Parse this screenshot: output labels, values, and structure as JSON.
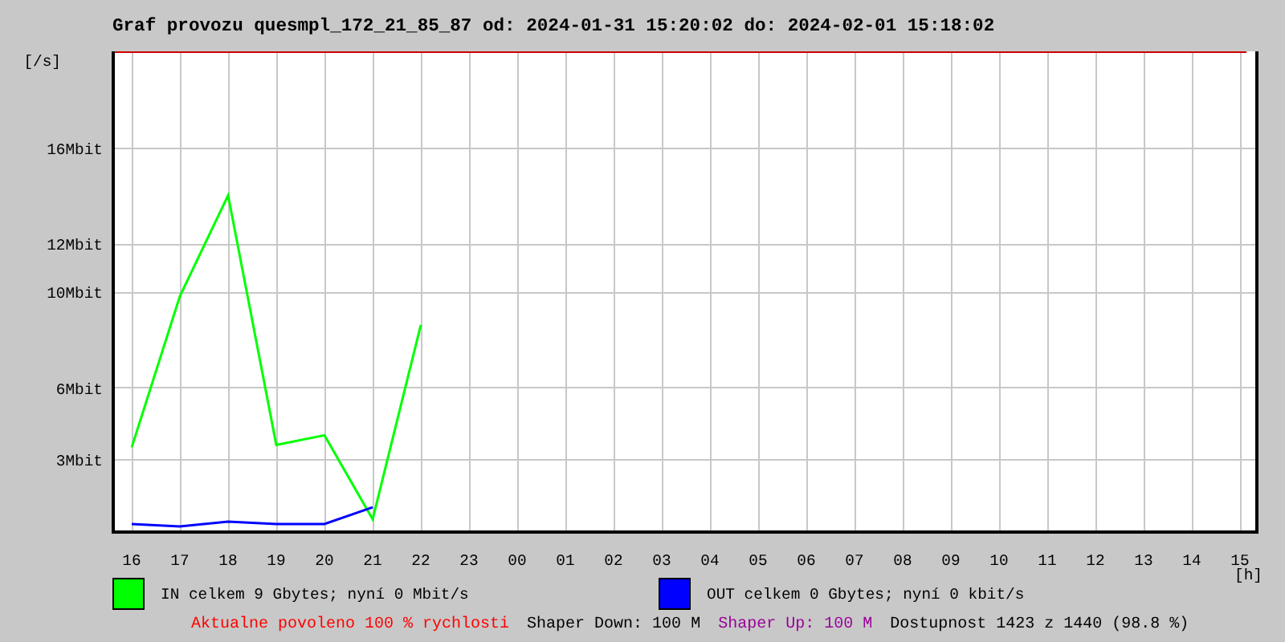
{
  "title": "Graf provozu quesmpl_172_21_85_87 od: 2024-01-31 15:20:02 do: 2024-02-01 15:18:02",
  "chart_data": {
    "type": "line",
    "ylabel": "[/s]",
    "xlabel": "[h]",
    "grid": true,
    "ylim": [
      0,
      20
    ],
    "yticks": [
      {
        "value": 3,
        "label": "3Mbit"
      },
      {
        "value": 6,
        "label": "6Mbit"
      },
      {
        "value": 10,
        "label": "10Mbit"
      },
      {
        "value": 12,
        "label": "12Mbit"
      },
      {
        "value": 16,
        "label": "16Mbit"
      }
    ],
    "categories": [
      "16",
      "17",
      "18",
      "19",
      "20",
      "21",
      "22",
      "23",
      "00",
      "01",
      "02",
      "03",
      "04",
      "05",
      "06",
      "07",
      "08",
      "09",
      "10",
      "11",
      "12",
      "13",
      "14",
      "15"
    ],
    "series": [
      {
        "color": "#00ff00",
        "values": [
          3.5,
          9.8,
          14.0,
          3.6,
          4.0,
          0.5,
          8.6,
          null,
          null,
          null,
          null,
          null,
          null,
          null,
          null,
          null,
          null,
          null,
          null,
          null,
          null,
          null,
          null,
          null
        ]
      },
      {
        "color": "#0000ff",
        "values": [
          0.3,
          0.2,
          0.4,
          0.3,
          0.3,
          1.0,
          null,
          null,
          null,
          null,
          null,
          null,
          null,
          null,
          null,
          null,
          null,
          null,
          null,
          null,
          null,
          null,
          null,
          null
        ]
      }
    ]
  },
  "legend": [
    {
      "color": "#00ff00",
      "text": "IN celkem 9 Gbytes; nyní 0 Mbit/s"
    },
    {
      "color": "#0000ff",
      "text": "OUT celkem 0 Gbytes; nyní 0 kbit/s"
    }
  ],
  "footer": [
    {
      "color": "#ff0000",
      "text": "Aktualne povoleno 100 % rychlosti"
    },
    {
      "color": "#000000",
      "text": "Shaper Down: 100 M"
    },
    {
      "color": "#990099",
      "text": "Shaper Up: 100 M"
    },
    {
      "color": "#000000",
      "text": "Dostupnost 1423 z 1440 (98.8 %)"
    }
  ]
}
